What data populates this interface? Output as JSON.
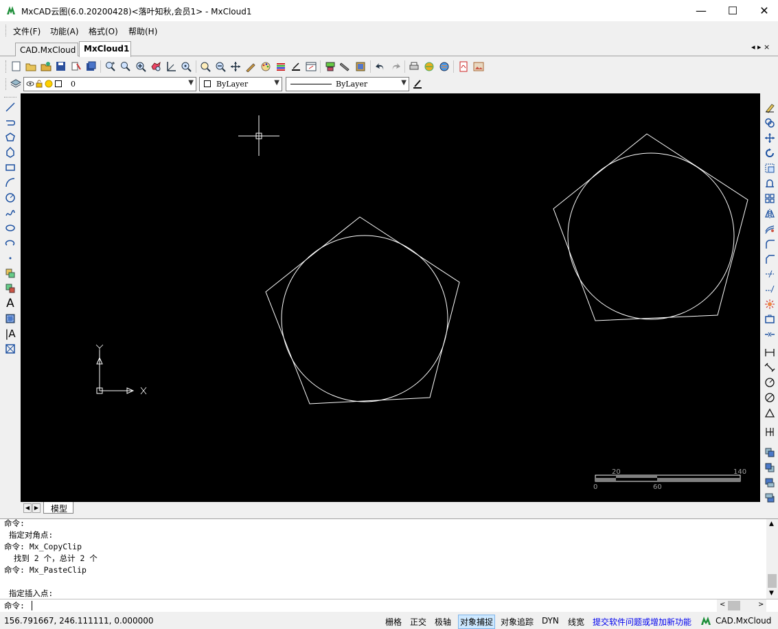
{
  "window": {
    "title": "MxCAD云图(6.0.20200428)<落叶知秋,会员1> - MxCloud1",
    "minimize": "—",
    "maximize": "☐",
    "close": "✕"
  },
  "menu": {
    "items": [
      "文件(F)",
      "功能(A)",
      "格式(O)",
      "帮助(H)"
    ]
  },
  "tabs": {
    "items": [
      "CAD.MxCloud",
      "MxCloud1"
    ],
    "active": "MxCloud1",
    "nav": "◂ ▸ ×"
  },
  "layer_toolbar": {
    "layer_value": "0",
    "color_value": "ByLayer",
    "linetype_value": "ByLayer"
  },
  "canvas": {
    "background": "#000000",
    "ucs_x": "X",
    "ucs_y": "Y",
    "scale_labels": [
      "20",
      "140",
      "0",
      "60"
    ]
  },
  "model_tab": {
    "label": "模型"
  },
  "command": {
    "history": [
      "命令:",
      " 指定对角点:",
      "命令: Mx_CopyClip",
      "  找到 2 个，总计 2 个",
      "命令: Mx_PasteClip",
      "",
      " 指定插入点:"
    ],
    "prompt": "命令:"
  },
  "status": {
    "coords": "156.791667,  246.111111,  0.000000",
    "toggles": [
      "栅格",
      "正交",
      "极轴",
      "对象捕捉",
      "对象追踪",
      "DYN",
      "线宽"
    ],
    "active_toggle": "对象捕捉",
    "feedback_link": "提交软件问题或增加新功能",
    "brand": "CAD.MxCloud",
    "link_color": "#0000ee"
  }
}
